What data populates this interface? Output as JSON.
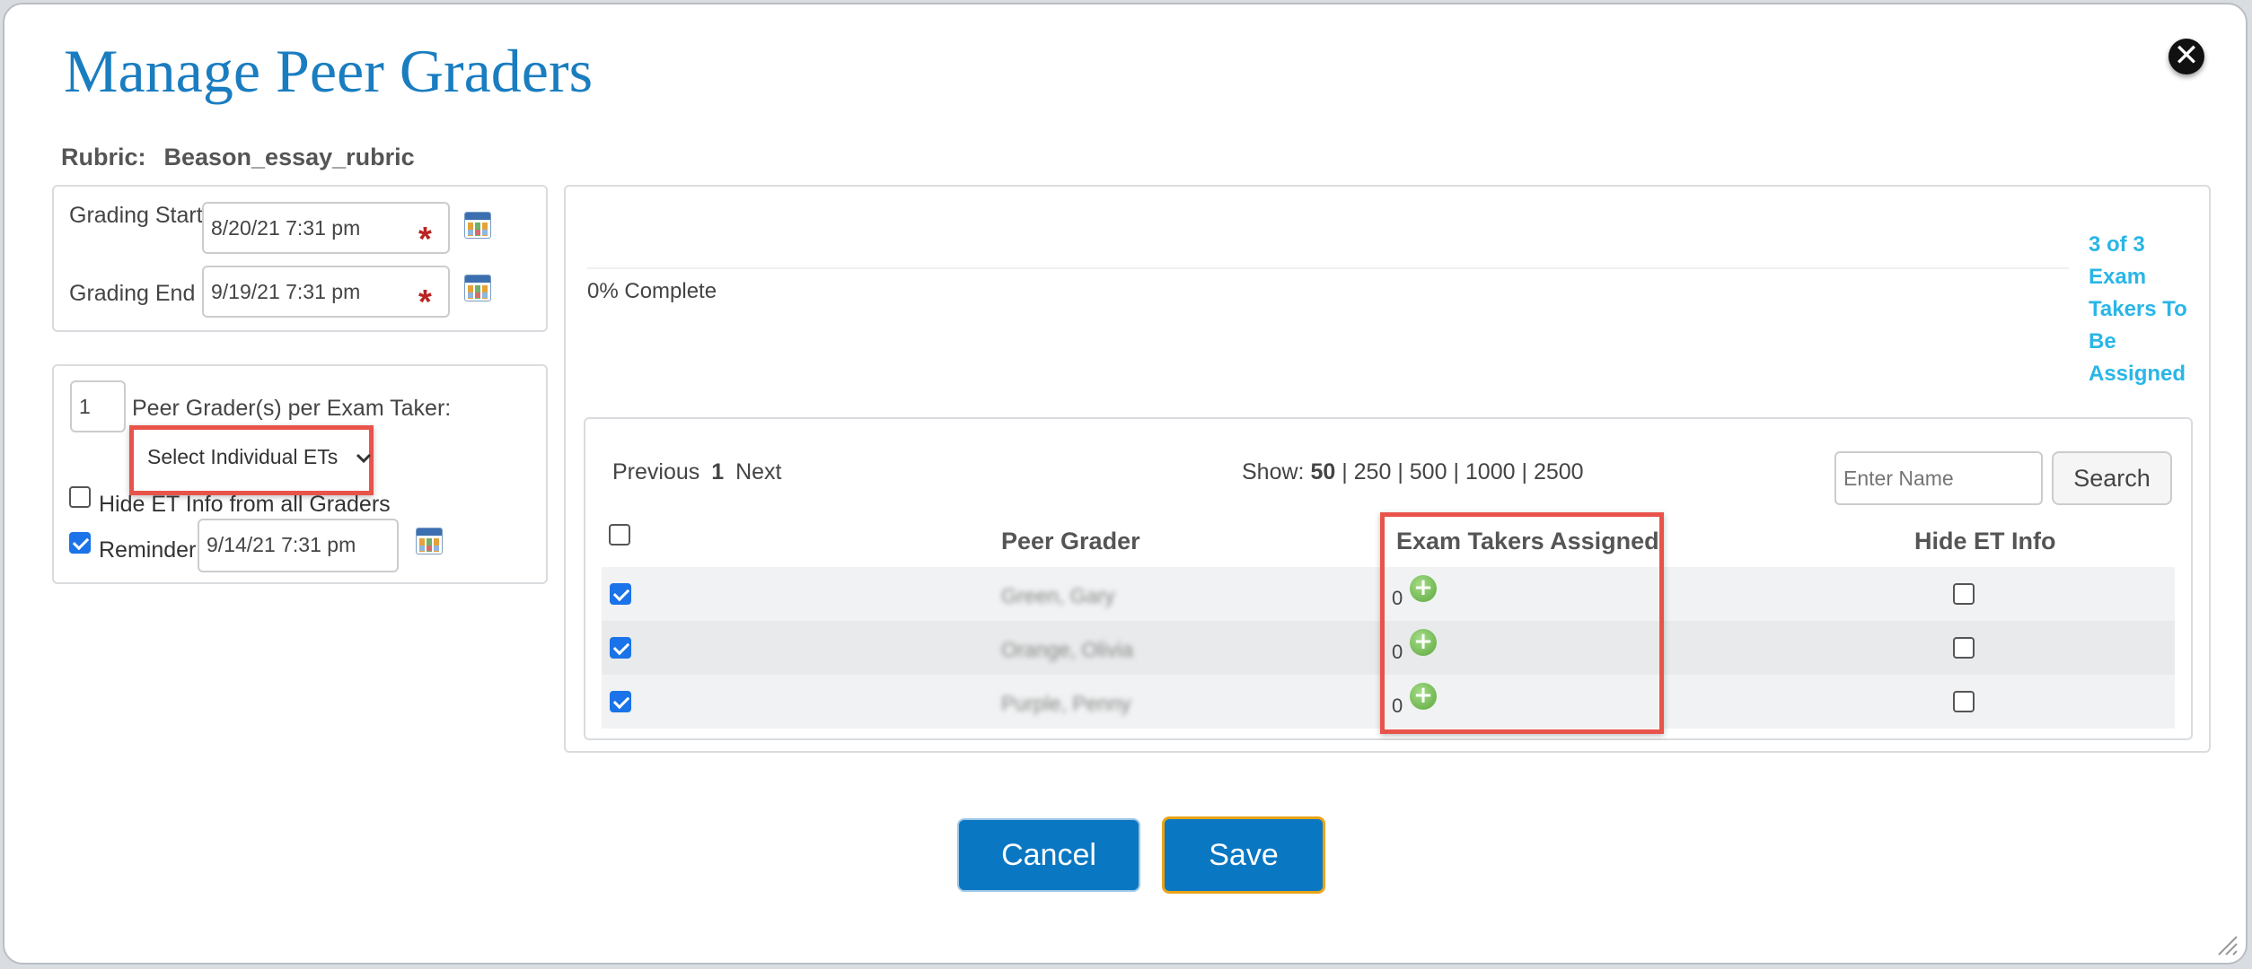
{
  "dialog": {
    "title": "Manage Peer Graders",
    "close_glyph": "✕"
  },
  "rubric": {
    "label": "Rubric:",
    "value": "Beason_essay_rubric"
  },
  "schedule": {
    "start_label": "Grading Start",
    "start_value": "8/20/21 7:31 pm",
    "end_label": "Grading End",
    "end_value": "9/19/21 7:31 pm",
    "required_mark": "*"
  },
  "settings": {
    "graders_count": "1",
    "graders_label": "Peer Grader(s) per Exam Taker:",
    "assign_mode": "Select Individual ETs",
    "hide_label": "Hide ET Info from all Graders",
    "hide_checked": false,
    "reminder_label": "Reminder:",
    "reminder_checked": true,
    "reminder_value": "9/14/21 7:31 pm"
  },
  "progress": {
    "percent": 0,
    "label": "0% Complete",
    "status_lines": [
      "3 of 3",
      "Exam",
      "Takers To",
      "Be",
      "Assigned"
    ]
  },
  "pager": {
    "previous": "Previous",
    "current": "1",
    "next": "Next",
    "show_label": "Show:",
    "sizes": [
      "50",
      "250",
      "500",
      "1000",
      "2500"
    ],
    "separator": "|",
    "selected_size": "50"
  },
  "search": {
    "placeholder": "Enter Name",
    "button": "Search"
  },
  "table": {
    "col_grader": "Peer Grader",
    "col_assigned": "Exam Takers Assigned",
    "col_hide": "Hide ET Info",
    "rows": [
      {
        "name": "Green, Gary",
        "assigned": "0",
        "selected": true,
        "hide": false
      },
      {
        "name": "Orange, Olivia",
        "assigned": "0",
        "selected": true,
        "hide": false
      },
      {
        "name": "Purple, Penny",
        "assigned": "0",
        "selected": true,
        "hide": false
      }
    ]
  },
  "actions": {
    "cancel": "Cancel",
    "save": "Save"
  },
  "colors": {
    "title": "#1a7dc0",
    "primary": "#0a77c2",
    "highlight": "#e8534a",
    "save_border": "#e8a317",
    "link": "#29b6e6"
  },
  "icons": [
    "close-icon",
    "calendar-icon",
    "required-asterisk",
    "chevron-down-icon",
    "add-icon",
    "resize-grip-icon"
  ]
}
